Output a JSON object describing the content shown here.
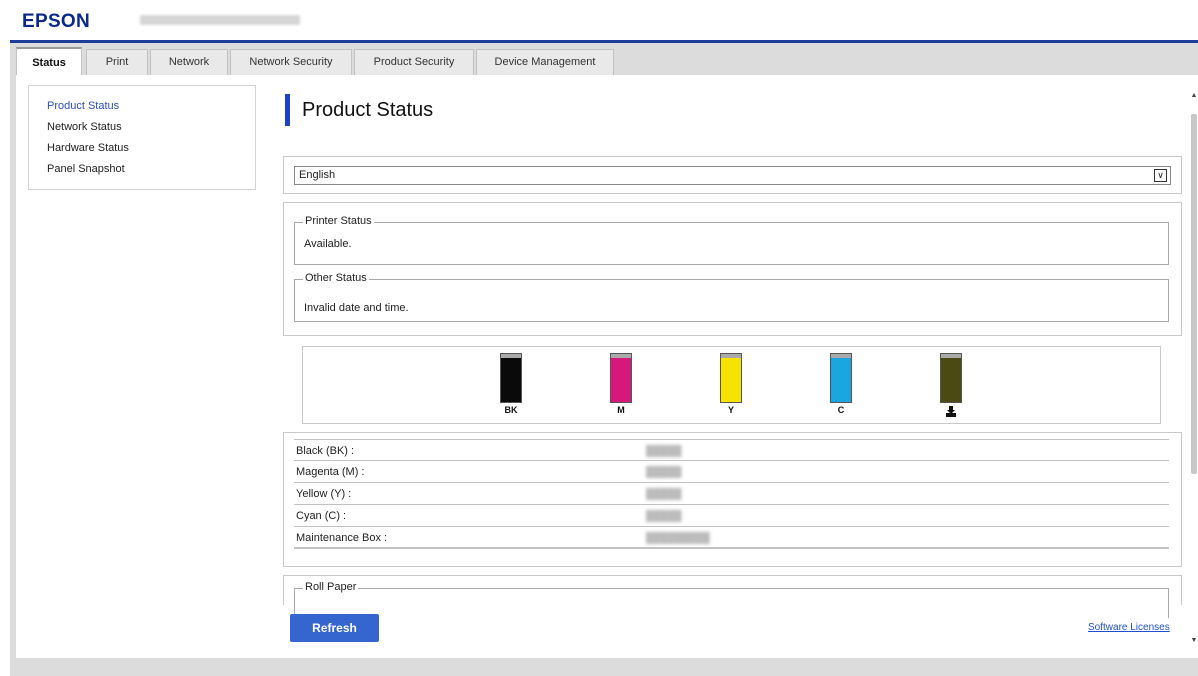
{
  "header": {
    "logo": "EPSON",
    "model_obscured": true
  },
  "tabs": [
    {
      "label": "Status",
      "active": true
    },
    {
      "label": "Print",
      "active": false
    },
    {
      "label": "Network",
      "active": false
    },
    {
      "label": "Network Security",
      "active": false
    },
    {
      "label": "Product Security",
      "active": false
    },
    {
      "label": "Device Management",
      "active": false
    }
  ],
  "sidebar": {
    "items": [
      {
        "label": "Product Status",
        "active": true
      },
      {
        "label": "Network Status",
        "active": false
      },
      {
        "label": "Hardware Status",
        "active": false
      },
      {
        "label": "Panel Snapshot",
        "active": false
      }
    ]
  },
  "main": {
    "title": "Product Status",
    "language": {
      "selected": "English",
      "arrow": "chevron-down-icon"
    },
    "printer_status": {
      "legend": "Printer Status",
      "text": "Available."
    },
    "other_status": {
      "legend": "Other Status",
      "text": "Invalid date and time."
    },
    "ink": [
      {
        "label": "BK",
        "color": "#0a0a0a",
        "level": 0.92
      },
      {
        "label": "M",
        "color": "#d6187a",
        "level": 0.92
      },
      {
        "label": "Y",
        "color": "#f7e300",
        "level": 0.92
      },
      {
        "label": "C",
        "color": "#1aa7e0",
        "level": 0.92
      },
      {
        "label": "",
        "icon": "maintenance-box-icon",
        "color": "#4a4a12",
        "level": 0.92
      }
    ],
    "levels": [
      {
        "label": "Black (BK) :"
      },
      {
        "label": "Magenta (M) :"
      },
      {
        "label": "Yellow (Y) :"
      },
      {
        "label": "Cyan (C) :"
      },
      {
        "label": "Maintenance Box :"
      }
    ],
    "roll_paper": {
      "legend": "Roll Paper"
    },
    "refresh_label": "Refresh",
    "software_licenses": "Software Licenses"
  },
  "colors": {
    "brand": "#0a2a8a",
    "accent": "#1e3fc8",
    "button": "#3566cf",
    "link": "#1f4fd0"
  }
}
